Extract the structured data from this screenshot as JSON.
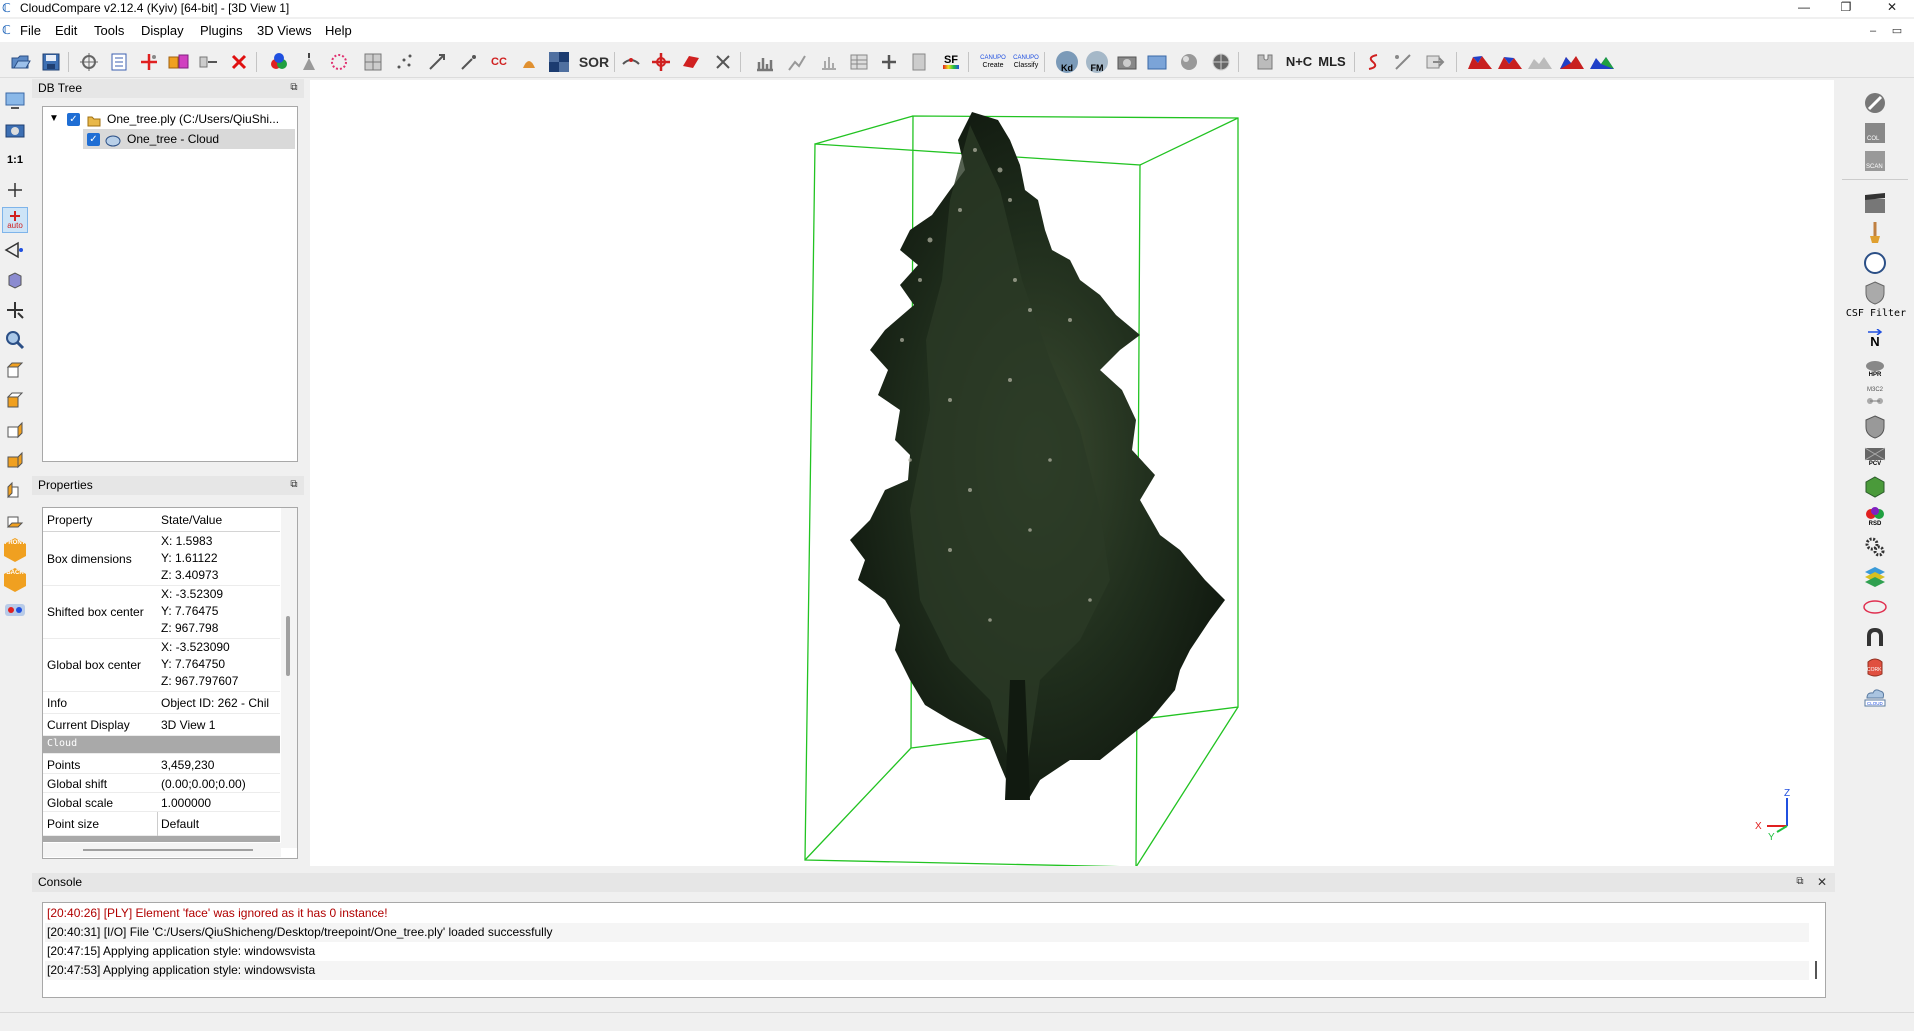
{
  "window": {
    "title": "CloudCompare v2.12.4 (Kyiv) [64-bit] - [3D View 1]"
  },
  "menu": [
    "File",
    "Edit",
    "Tools",
    "Display",
    "Plugins",
    "3D Views",
    "Help"
  ],
  "toolbar": {
    "one_to_one": "1:1",
    "sor": "SOR",
    "cc": "CC",
    "sf": "SF",
    "kd": "Kd",
    "fm": "FM",
    "npc": "N+C",
    "mls": "MLS",
    "canupo_create": "Create",
    "canupo_classify": "Classify"
  },
  "lefttoolbar": {
    "zoom_1to1": "1:1",
    "auto": "auto",
    "front": "FRONT",
    "back": "BACK"
  },
  "dbtree": {
    "title": "DB Tree",
    "root": "One_tree.ply (C:/Users/QiuShi...",
    "child": "One_tree - Cloud"
  },
  "properties": {
    "title": "Properties",
    "header_property": "Property",
    "header_value": "State/Value",
    "box_dimensions": {
      "label": "Box dimensions",
      "x": "X: 1.5983",
      "y": "Y: 1.61122",
      "z": "Z: 3.40973"
    },
    "shifted_center": {
      "label": "Shifted box center",
      "x": "X: -3.52309",
      "y": "Y: 7.76475",
      "z": "Z: 967.798"
    },
    "global_center": {
      "label": "Global box center",
      "x": "X: -3.523090",
      "y": "Y: 7.764750",
      "z": "Z: 967.797607"
    },
    "info": {
      "label": "Info",
      "value": "Object ID: 262 - Chil"
    },
    "current_display": {
      "label": "Current Display",
      "value": "3D View 1"
    },
    "section_cloud": "Cloud",
    "points": {
      "label": "Points",
      "value": "3,459,230"
    },
    "global_shift": {
      "label": "Global shift",
      "value": "(0.00;0.00;0.00)"
    },
    "global_scale": {
      "label": "Global scale",
      "value": "1.000000"
    },
    "point_size": {
      "label": "Point size",
      "value": "Default"
    }
  },
  "righttoolbar": {
    "csf_filter": "CSF Filter",
    "n_label": "N",
    "hpr": "HPR",
    "m3c2": "M3C2",
    "pcv": "PCV",
    "rsd": "RSD",
    "cork": "CORK",
    "cloud_label": "CLOUD"
  },
  "axes": {
    "x": "X",
    "y": "Y",
    "z": "Z"
  },
  "console": {
    "title": "Console",
    "lines": [
      {
        "text": "[20:40:26] [PLY] Element 'face' was ignored as it has 0 instance!",
        "color": "#b00000"
      },
      {
        "text": "[20:40:31] [I/O] File 'C:/Users/QiuShicheng/Desktop/treepoint/One_tree.ply' loaded successfully",
        "color": "#000000"
      },
      {
        "text": "[20:47:15] Applying application style: windowsvista",
        "color": "#000000"
      },
      {
        "text": "[20:47:53] Applying application style: windowsvista",
        "color": "#000000"
      }
    ]
  },
  "colors": {
    "bbox": "#22c322",
    "tree_dark": "#1b2a1b",
    "accent": "#1f6ed4",
    "error": "#b00000"
  }
}
